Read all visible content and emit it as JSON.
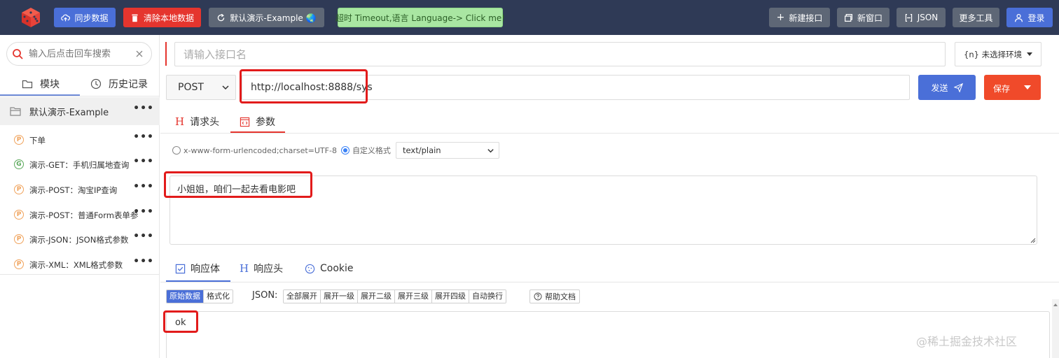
{
  "topbar": {
    "sync_label": "同步数据",
    "clear_label": "清除本地数据",
    "demo_label": "默认演示-Example 🌏",
    "timeout_label": "超时 Timeout,语言 Language-> Click me!",
    "new_api_label": "新建接口",
    "new_window_label": "新窗口",
    "json_label": "JSON",
    "more_tools_label": "更多工具",
    "login_label": "登录",
    "colors": {
      "bar": "#2f3a56",
      "primary": "#4a6fd8",
      "danger": "#e5352e",
      "neutral": "#5e6776",
      "green": "#a9e6a2"
    }
  },
  "sidebar": {
    "search_placeholder": "输入后点击回车搜索",
    "tab_module": "模块",
    "tab_history": "历史记录",
    "group_label": "默认演示-Example",
    "items": [
      {
        "badge": "P",
        "label": "下单"
      },
      {
        "badge": "G",
        "label": "演示-GET：手机归属地查询"
      },
      {
        "badge": "P",
        "label": "演示-POST：淘宝IP查询"
      },
      {
        "badge": "P",
        "label": "演示-POST：普通Form表单参"
      },
      {
        "badge": "P",
        "label": "演示-JSON：JSON格式参数"
      },
      {
        "badge": "P",
        "label": "演示-XML：XML格式参数"
      }
    ],
    "more_dots": "•••"
  },
  "request": {
    "name_placeholder": "请输入接口名",
    "env_label": "{n} 未选择环境",
    "method": "POST",
    "url": "http://localhost:8888/sys",
    "send_label": "发送",
    "save_label": "保存",
    "tab_headers": "请求头",
    "tab_params": "参数",
    "radio_form": "x-www-form-urlencoded;charset=UTF-8",
    "radio_custom": "自定义格式",
    "content_type": "text/plain",
    "body": "小姐姐，咱们一起去看电影吧"
  },
  "response": {
    "tab_body": "响应体",
    "tab_headers": "响应头",
    "tab_cookie": "Cookie",
    "view_raw": "原始数据",
    "view_format": "格式化",
    "json_label": "JSON:",
    "expand_buttons": [
      "全部展开",
      "展开一级",
      "展开二级",
      "展开三级",
      "展开四级",
      "自动换行"
    ],
    "help_label": "帮助文档",
    "body": "ok"
  },
  "watermark": "@稀土掘金技术社区"
}
